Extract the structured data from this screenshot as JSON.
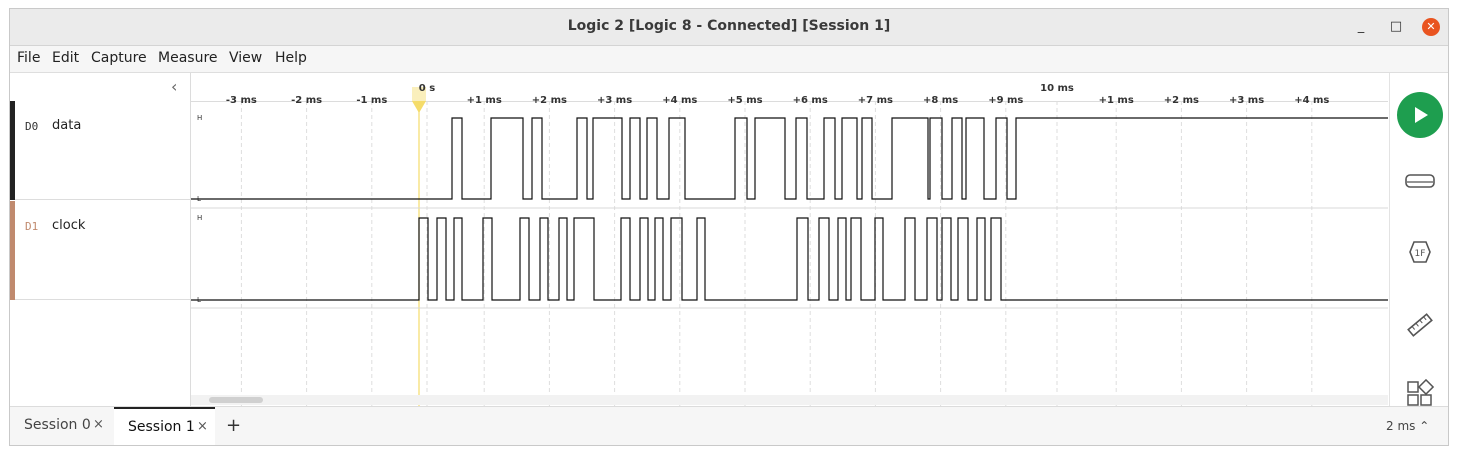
{
  "window": {
    "title": "Logic 2 [Logic 8 - Connected] [Session 1]",
    "minimize": "_",
    "maximize": "□",
    "close": "✕"
  },
  "menu": [
    "File",
    "Edit",
    "Capture",
    "Measure",
    "View",
    "Help"
  ],
  "left_panel": {
    "collapse_glyph": "‹"
  },
  "channels": [
    {
      "num": "D0",
      "name": "data",
      "color": "#222222"
    },
    {
      "num": "D1",
      "name": "clock",
      "color": "#c08a6e"
    }
  ],
  "timeline": {
    "zero_label": "0 s",
    "ten_label": "10 ms",
    "ticks_before_zero": [
      "-3 ms",
      "-2 ms",
      "-1 ms"
    ],
    "ticks_after_zero": [
      "+1 ms",
      "+2 ms",
      "+3 ms",
      "+4 ms",
      "+5 ms",
      "+6 ms",
      "+7 ms",
      "+8 ms",
      "+9 ms"
    ],
    "ticks_after_ten": [
      "+1 ms",
      "+2 ms",
      "+3 ms",
      "+4 ms"
    ],
    "level_high": "H",
    "level_low": "L"
  },
  "right_toolbar": [
    {
      "name": "start-capture",
      "icon": "play-icon"
    },
    {
      "name": "timing-markers",
      "icon": "marker-icon"
    },
    {
      "name": "analyzers",
      "icon": "analyzer-1f-icon",
      "label": "1F"
    },
    {
      "name": "measurements",
      "icon": "ruler-icon"
    },
    {
      "name": "extensions",
      "icon": "extensions-icon"
    }
  ],
  "tabs": [
    {
      "label": "Session 0",
      "close": "×",
      "active": false
    },
    {
      "label": "Session 1",
      "close": "×",
      "active": true
    }
  ],
  "add_tab": "+",
  "time_scale": "2 ms ⌃",
  "colors": {
    "play": "#1e9e4f",
    "close": "#e95420",
    "trigger": "#f5dc6a"
  }
}
